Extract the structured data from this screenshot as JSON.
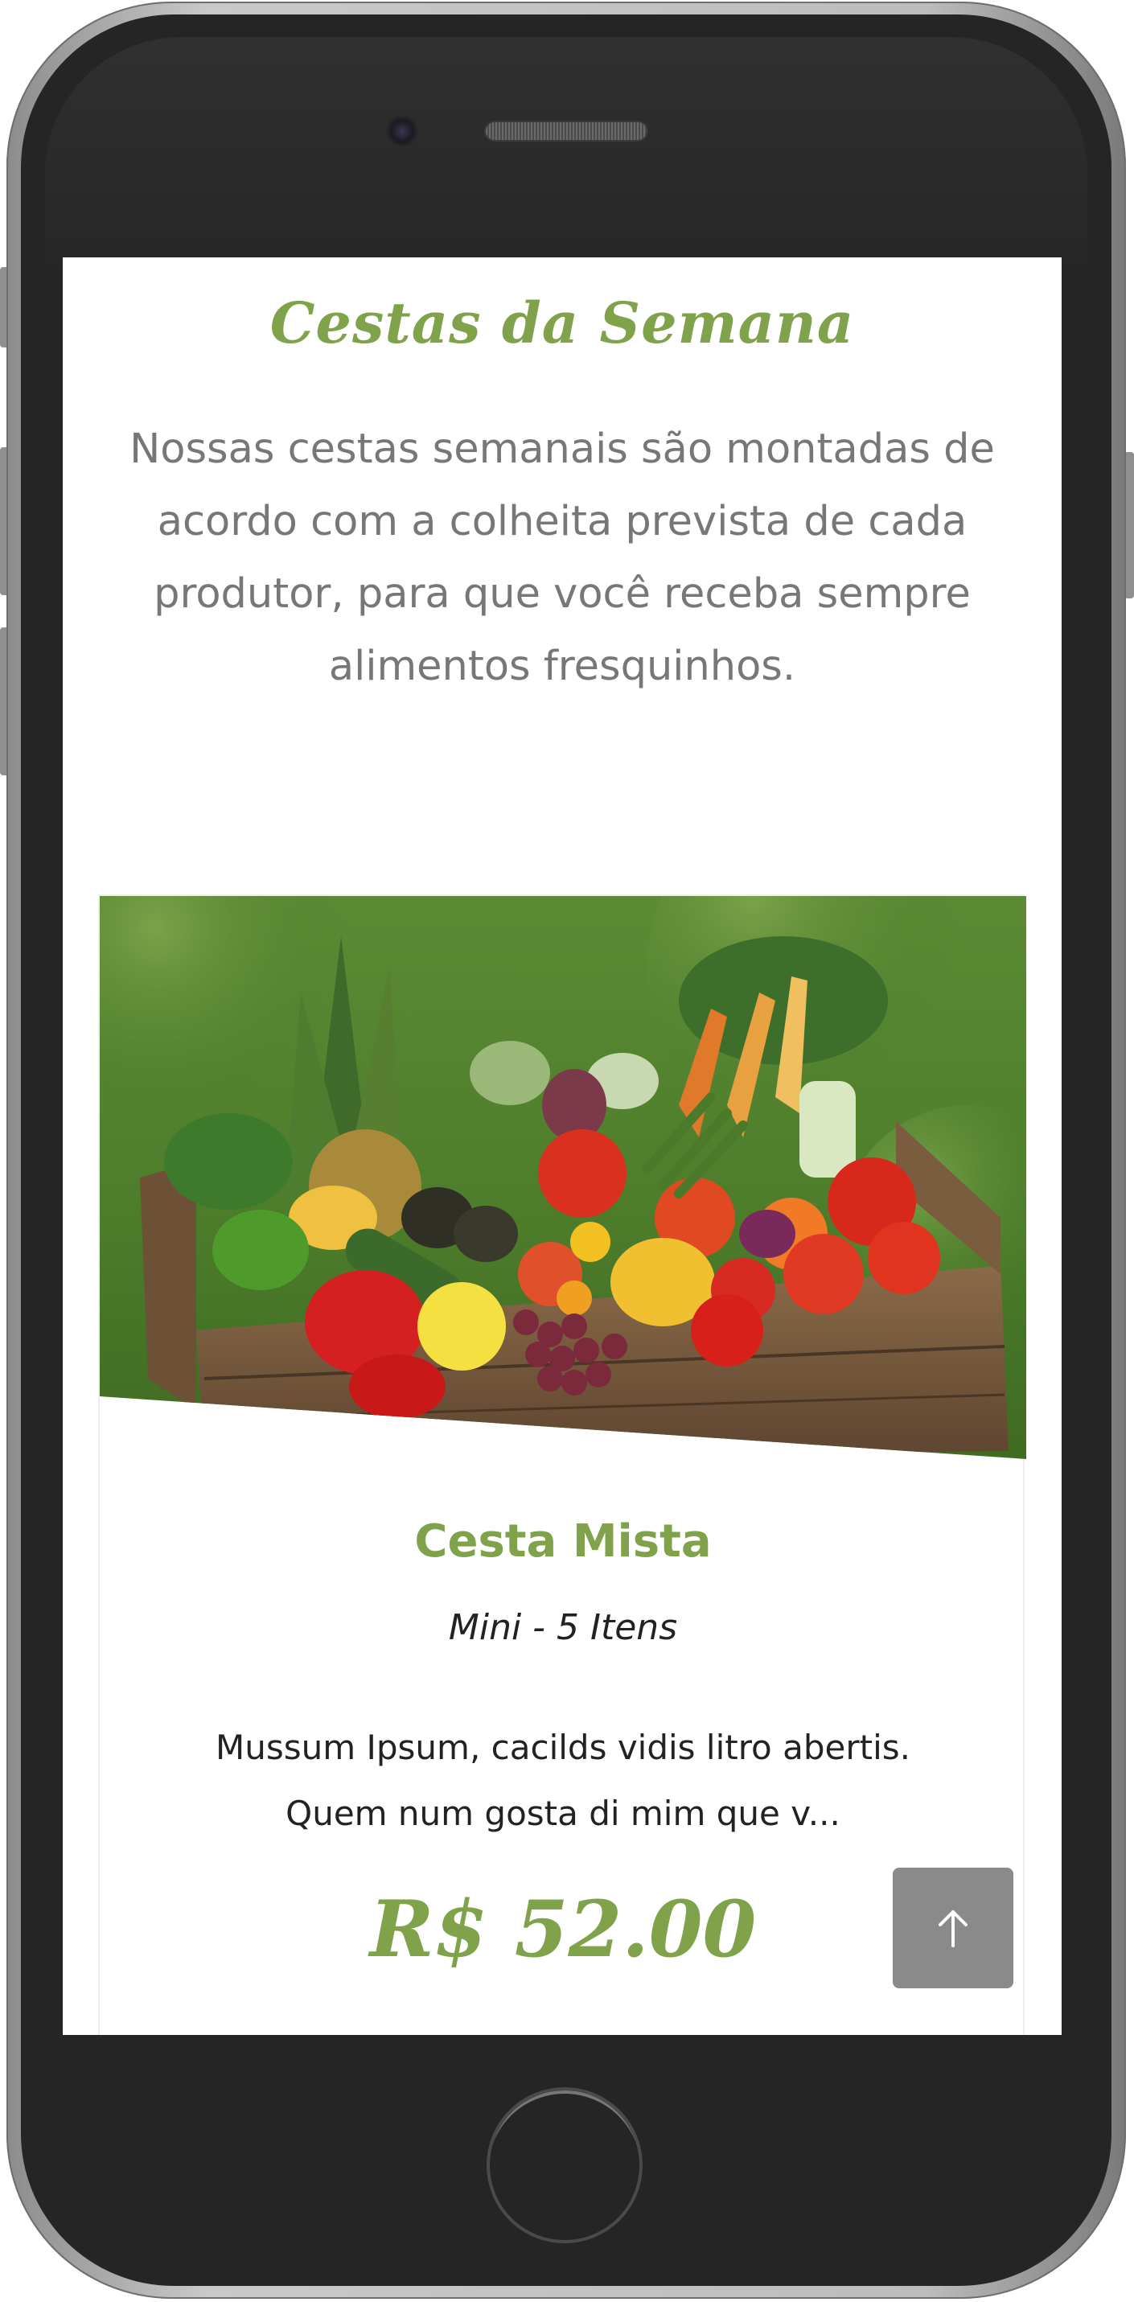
{
  "section": {
    "title": "Cestas da Semana",
    "description": "Nossas cestas semanais são montadas de acordo com a colheita prevista de cada produtor, para que você receba sempre alimentos fresquinhos."
  },
  "product": {
    "name": "Cesta Mista",
    "size_label": "Mini - 5 Itens",
    "excerpt": "Mussum Ipsum, cacilds vidis litro abertis. Quem num gosta di mim que v...",
    "price": "R$ 52.00",
    "image_icon": "vegetable-basket-photo"
  },
  "controls": {
    "back_to_top_icon": "arrow-up-icon"
  },
  "colors": {
    "accent_green": "#7fa24a",
    "text_gray": "#777777",
    "button_gray": "#8a8a8a"
  }
}
